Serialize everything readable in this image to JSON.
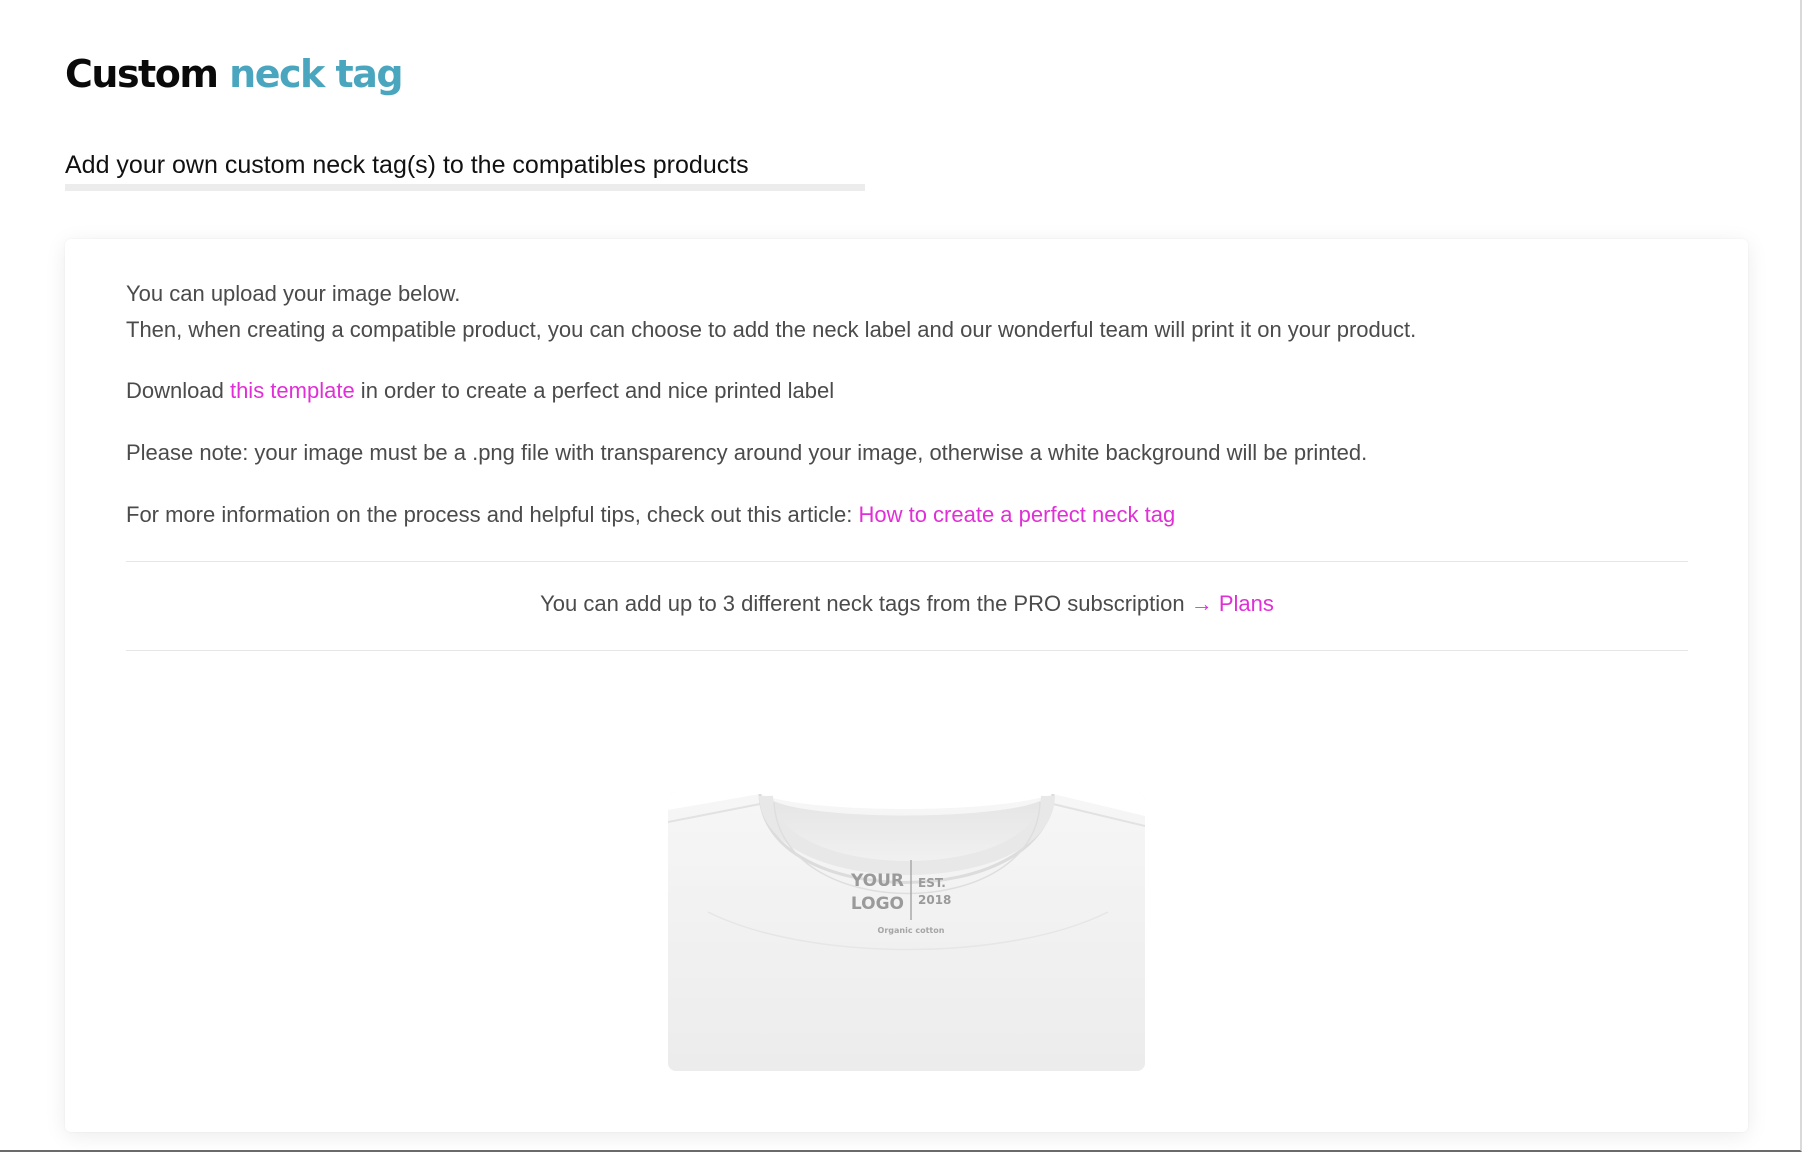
{
  "header": {
    "title_part1": "Custom",
    "title_part2": "neck tag",
    "subtitle": "Add your own custom neck tag(s) to the compatibles products"
  },
  "info": {
    "line1": "You can upload your image below.",
    "line2": "Then, when creating a compatible product, you can choose to add the neck label and our wonderful team will print it on your product.",
    "download_prefix": "Download ",
    "template_link": "this template",
    "download_suffix": " in order to create a perfect and nice printed label",
    "note": "Please note: your image must be a .png file with transparency around your image, otherwise a white background will be printed.",
    "article_prefix": "For more information on the process and helpful tips, check out this article: ",
    "article_link": "How to create a perfect neck tag"
  },
  "subscription": {
    "text": "You can add up to 3 different neck tags from the PRO subscription ",
    "plans_link": "→ Plans"
  },
  "preview": {
    "tag_your": "YOUR",
    "tag_logo": "LOGO",
    "tag_est": "EST.",
    "tag_year": "2018",
    "tag_caption": "Organic cotton"
  },
  "colors": {
    "accent": "#4aa6bf",
    "link": "#e02fd6",
    "text": "#4b4b4b"
  }
}
